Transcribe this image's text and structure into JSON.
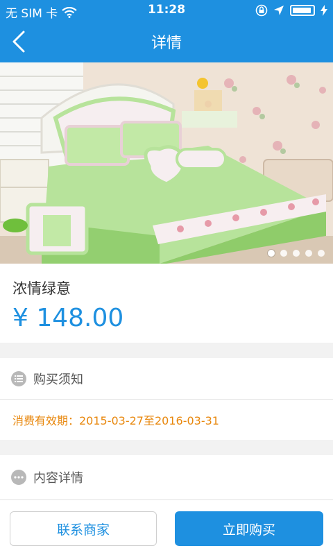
{
  "status_bar": {
    "carrier": "无 SIM 卡",
    "time": "11:28",
    "battery_level": 0.95,
    "icons": [
      "wifi-icon",
      "rotation-lock-icon",
      "location-arrow-icon",
      "battery-icon",
      "charging-icon"
    ]
  },
  "nav": {
    "title": "详情",
    "back_icon": "chevron-left-icon"
  },
  "gallery": {
    "image_description_icon": "product-photo",
    "slide_count": 5,
    "active_index": 0
  },
  "product": {
    "name": "浓情绿意",
    "price": "¥ 148.00"
  },
  "notice": {
    "title": "购买须知",
    "icon": "list-icon",
    "validity": "消费有效期：2015-03-27至2016-03-31"
  },
  "details": {
    "title": "内容详情",
    "icon": "more-icon"
  },
  "actions": {
    "contact_label": "联系商家",
    "buy_label": "立即购买"
  },
  "colors": {
    "primary": "#1e90e0",
    "validity_text": "#e8870c",
    "background": "#f2f2f2"
  }
}
